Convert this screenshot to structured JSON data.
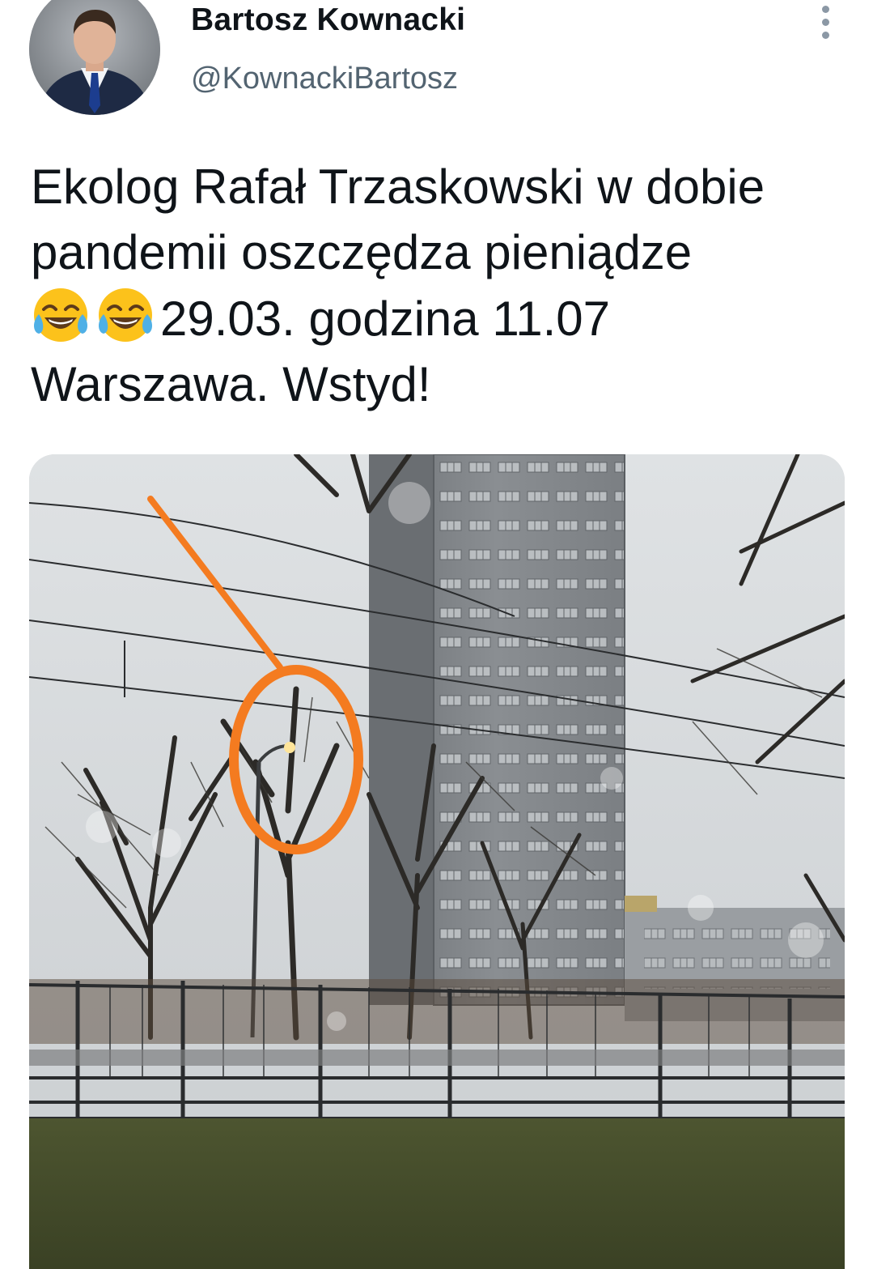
{
  "author": {
    "name": "Bartosz Kownacki",
    "handle": "@KownackiBartosz",
    "avatar_icon": "profile-photo"
  },
  "more_icon": "more-vertical-icon",
  "tweet": {
    "line1": "Ekolog Rafał Trzaskowski w dobie",
    "line2": "pandemii oszczędza pieniądze",
    "emoji_name": "face-with-tears-of-joy",
    "emoji_count": 2,
    "line3_text": "29.03. godzina 11.07",
    "line4": "Warszawa. Wstyd!"
  },
  "media": {
    "type": "photo",
    "subject": "street-lamp-lit-in-daytime",
    "accent_color": "#f47b20"
  }
}
